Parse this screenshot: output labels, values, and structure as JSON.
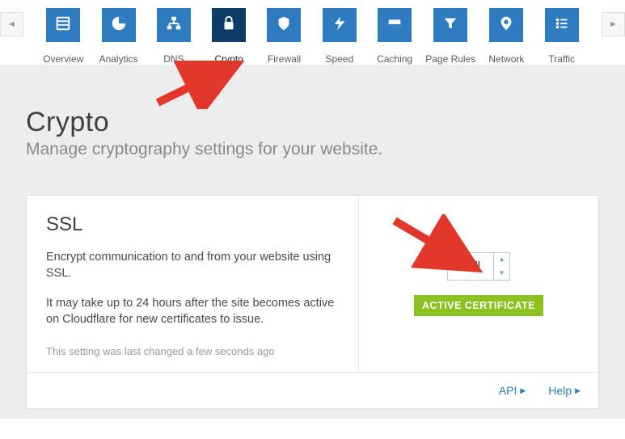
{
  "nav": {
    "items": [
      {
        "label": "Overview"
      },
      {
        "label": "Analytics"
      },
      {
        "label": "DNS"
      },
      {
        "label": "Crypto"
      },
      {
        "label": "Firewall"
      },
      {
        "label": "Speed"
      },
      {
        "label": "Caching"
      },
      {
        "label": "Page Rules"
      },
      {
        "label": "Network"
      },
      {
        "label": "Traffic"
      }
    ]
  },
  "page": {
    "title": "Crypto",
    "subtitle": "Manage cryptography settings for your website."
  },
  "ssl": {
    "title": "SSL",
    "desc": "Encrypt communication to and from your website using SSL.",
    "note": "It may take up to 24 hours after the site becomes active on Cloudflare for new certificates to issue.",
    "meta": "This setting was last changed a few seconds ago",
    "select_value": "Full",
    "badge": "ACTIVE CERTIFICATE",
    "footer": {
      "api": "API",
      "help": "Help"
    }
  }
}
